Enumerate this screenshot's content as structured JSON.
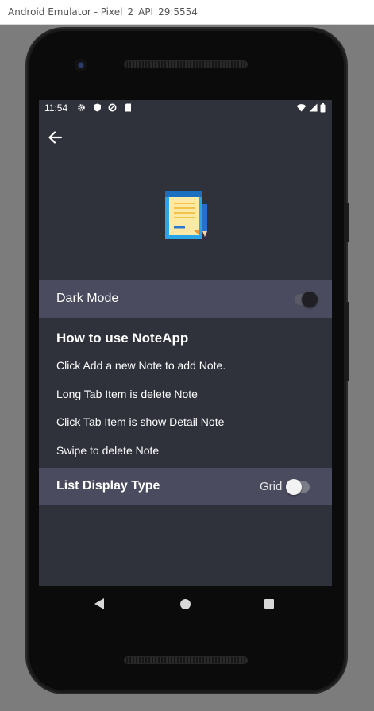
{
  "window": {
    "title": "Android Emulator - Pixel_2_API_29:5554"
  },
  "status_bar": {
    "time": "11:54",
    "left_icons": [
      "gear-icon",
      "shield-icon",
      "data-saver-icon",
      "sd-card-icon"
    ],
    "right_icons": [
      "wifi-icon",
      "signal-icon",
      "battery-icon"
    ]
  },
  "app_bar": {
    "back_icon": "arrow-left-icon"
  },
  "settings": {
    "dark_mode_label": "Dark Mode",
    "dark_mode_on": true,
    "howto_title": "How to use NoteApp",
    "howto_lines": [
      "Click Add a new Note to add Note.",
      "Long Tab Item is delete Note",
      "Click Tab Item is show Detail Note",
      "Swipe to delete Note"
    ],
    "list_display_label": "List Display Type",
    "list_display_value": "Grid",
    "list_display_on": false
  },
  "colors": {
    "background": "#2f313b",
    "row_background": "#4a4b5e",
    "text": "#ffffff"
  }
}
